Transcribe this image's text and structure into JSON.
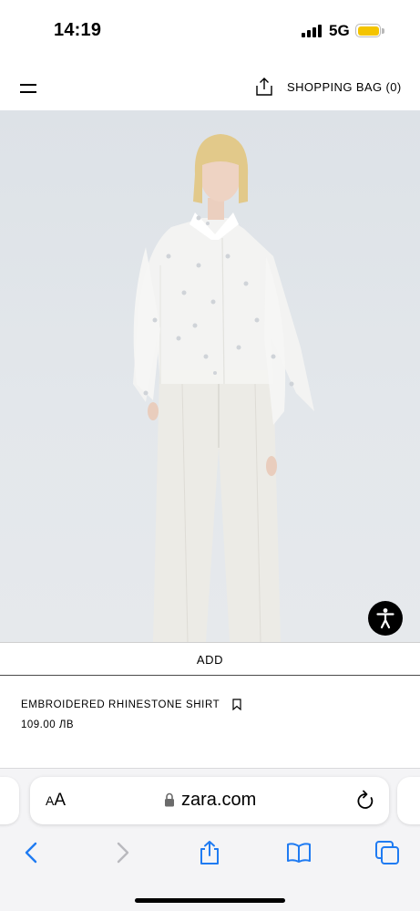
{
  "status_bar": {
    "time": "14:19",
    "network": "5G",
    "battery_color": "#f4c400"
  },
  "header": {
    "menu_icon": "hamburger-menu-icon",
    "share_icon": "share-icon",
    "bag_label": "SHOPPING BAG (0)"
  },
  "product": {
    "image_description_icon": "product-photo",
    "add_label": "ADD",
    "name": "EMBROIDERED RHINESTONE SHIRT",
    "price": "109.00 ЛВ"
  },
  "accessibility_icon": "accessibility-icon",
  "browser": {
    "text_size_label_large": "A",
    "text_size_label_small": "A",
    "url": "zara.com",
    "toolbar": [
      "back-icon",
      "forward-icon",
      "share-icon",
      "bookmarks-icon",
      "tabs-icon"
    ],
    "accent_color": "#1f7bf2"
  }
}
